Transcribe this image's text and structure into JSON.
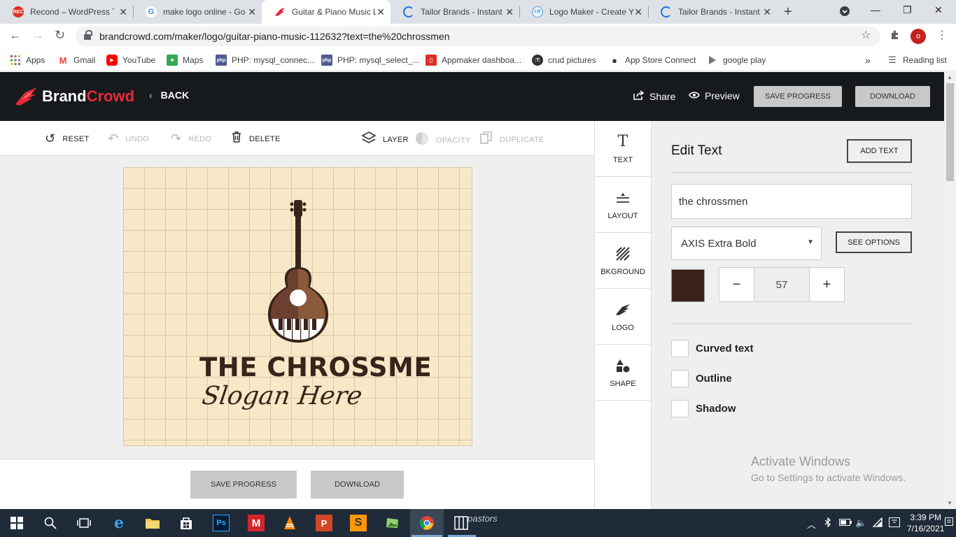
{
  "browser": {
    "tabs": [
      {
        "title": "Recond – WordPress T",
        "favicon": "rec-icon",
        "active": false
      },
      {
        "title": "make logo online - Go",
        "favicon": "google-icon",
        "active": false
      },
      {
        "title": "Guitar & Piano Music L",
        "favicon": "brandcrowd-icon",
        "active": true
      },
      {
        "title": "Tailor Brands - Instant",
        "favicon": "loading-icon",
        "active": false
      },
      {
        "title": "Logo Maker - Create Y",
        "favicon": "logomaker-icon",
        "active": false
      },
      {
        "title": "Tailor Brands - Instant",
        "favicon": "loading-icon",
        "active": false
      }
    ],
    "url": "brandcrowd.com/maker/logo/guitar-piano-music-112632?text=the%20chrossmen",
    "profile_initial": "o",
    "bookmarks": [
      {
        "label": "Apps"
      },
      {
        "label": "Gmail"
      },
      {
        "label": "YouTube"
      },
      {
        "label": "Maps"
      },
      {
        "label": "PHP: mysql_connec..."
      },
      {
        "label": "PHP: mysql_select_..."
      },
      {
        "label": "Appmaker dashboa..."
      },
      {
        "label": "crud pictures"
      },
      {
        "label": "App Store Connect"
      },
      {
        "label": "google play"
      }
    ],
    "more_bookmarks": "»",
    "reading_list": "Reading list"
  },
  "app": {
    "brand_part1": "Brand",
    "brand_part2": "Crowd",
    "back_label": "BACK",
    "share_label": "Share",
    "preview_label": "Preview",
    "save_progress_label": "SAVE PROGRESS",
    "download_label": "DOWNLOAD",
    "brand_accent": "#e8293b"
  },
  "toolbar": {
    "reset": "RESET",
    "undo": "UNDO",
    "redo": "REDO",
    "delete": "DELETE",
    "layer": "LAYER",
    "opacity": "OPACITY",
    "duplicate": "DUPLICATE"
  },
  "canvas": {
    "title_text": "THE CHROSSME",
    "slogan_text": "Slogan Here",
    "background_color": "#f7e9c8",
    "text_color": "#3a231a"
  },
  "bottom": {
    "save_progress": "SAVE PROGRESS",
    "download": "DOWNLOAD"
  },
  "side_nav": [
    {
      "label": "TEXT",
      "icon": "text-icon"
    },
    {
      "label": "LAYOUT",
      "icon": "layout-icon"
    },
    {
      "label": "BKGROUND",
      "icon": "background-icon"
    },
    {
      "label": "LOGO",
      "icon": "logo-icon"
    },
    {
      "label": "SHAPE",
      "icon": "shape-icon"
    }
  ],
  "panel": {
    "heading": "Edit Text",
    "add_text": "ADD TEXT",
    "text_value": "the chrossmen",
    "font_name": "AXIS Extra Bold",
    "see_options": "SEE OPTIONS",
    "color": "#3a211a",
    "font_size": "57",
    "minus": "−",
    "plus": "+",
    "checkboxes": [
      {
        "label": "Curved text",
        "checked": false
      },
      {
        "label": "Outline",
        "checked": false
      },
      {
        "label": "Shadow",
        "checked": false
      }
    ],
    "activate_title": "Activate Windows",
    "activate_sub": "Go to Settings to activate Windows."
  },
  "taskbar": {
    "search_text": "pastors",
    "time": "3:39 PM",
    "date": "7/16/2021"
  }
}
